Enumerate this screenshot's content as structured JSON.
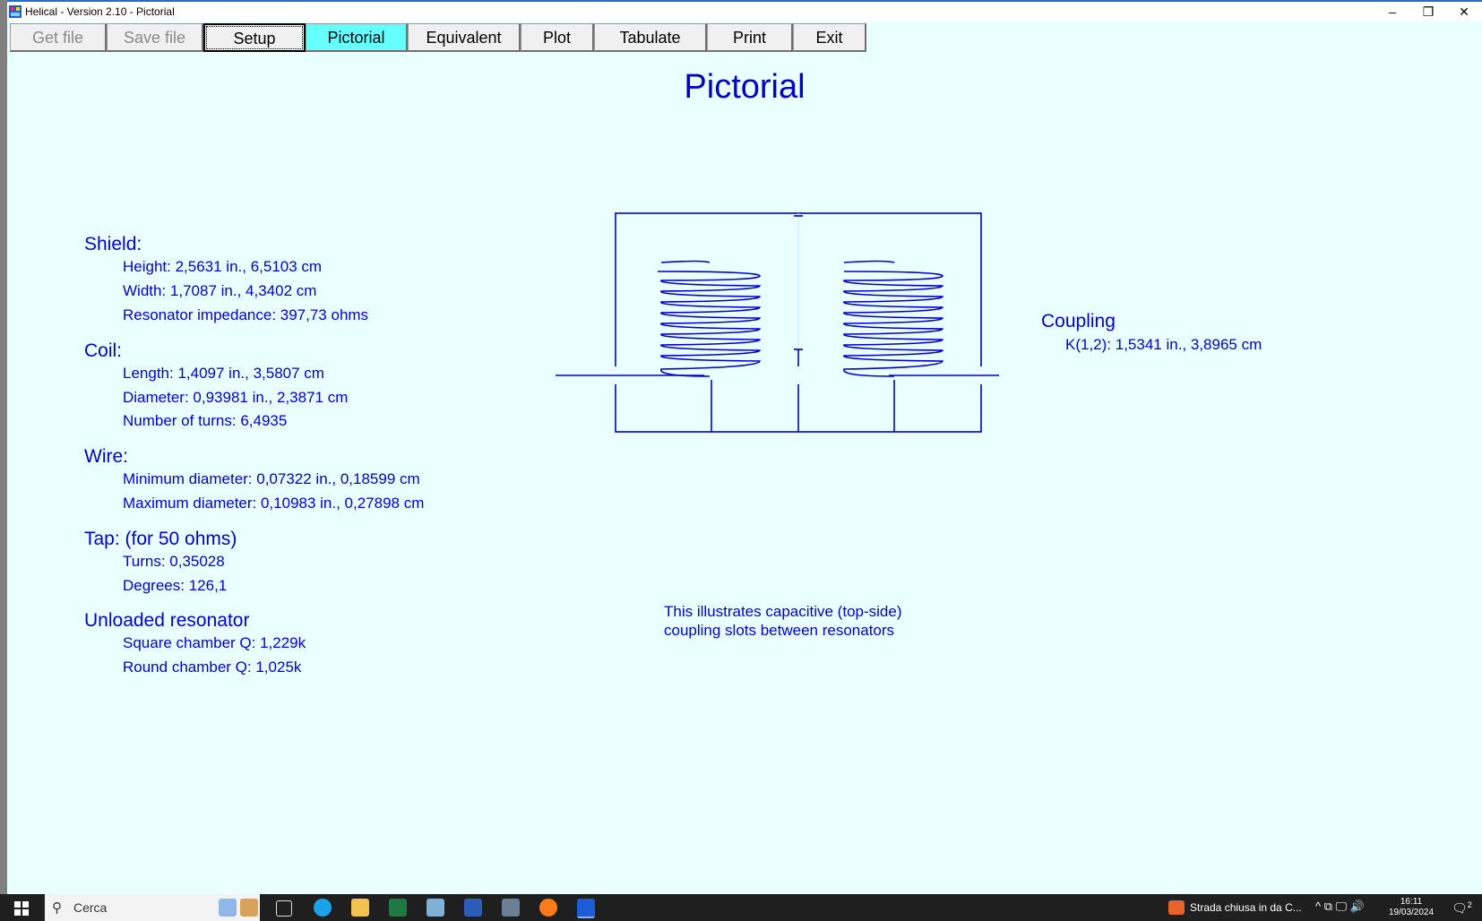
{
  "window": {
    "title": "Helical - Version 2.10 - Pictorial",
    "minimize": "–",
    "restore": "❐",
    "close": "✕"
  },
  "toolbar": {
    "get_file": "Get file",
    "save_file": "Save file",
    "setup": "Setup",
    "pictorial": "Pictorial",
    "equivalent": "Equivalent",
    "plot": "Plot",
    "tabulate": "Tabulate",
    "print": "Print",
    "exit": "Exit"
  },
  "page_title": "Pictorial",
  "shield": {
    "heading": "Shield:",
    "height": "Height: 2,5631 in.,  6,5103 cm",
    "width": "Width: 1,7087 in.,  4,3402 cm",
    "impedance": "Resonator impedance: 397,73 ohms"
  },
  "coil": {
    "heading": "Coil:",
    "length": "Length: 1,4097 in.,  3,5807 cm",
    "diameter": "Diameter: 0,93981 in.,  2,3871 cm",
    "turns": "Number of turns: 6,4935"
  },
  "wire": {
    "heading": "Wire:",
    "min": "Minimum diameter: 0,07322 in., 0,18599 cm",
    "max": "Maximum diameter: 0,10983 in., 0,27898 cm"
  },
  "tap": {
    "heading": "Tap: (for  50 ohms)",
    "turns": "Turns: 0,35028",
    "degrees": "Degrees: 126,1"
  },
  "unloaded": {
    "heading": "Unloaded resonator",
    "square": "Square chamber Q: 1,229k",
    "round": "Round chamber Q: 1,025k"
  },
  "coupling": {
    "heading": "Coupling",
    "k12": "K(1,2): 1,5341 in., 3,8965 cm"
  },
  "caption": {
    "line1": "This illustrates capacitive (top-side)",
    "line2": "coupling slots between resonators"
  },
  "taskbar": {
    "search_placeholder": "Cerca",
    "news": "Strada chiusa in da C...",
    "tray": "^  ⧉  🖵  🔊",
    "time": "16:11",
    "date": "19/03/2024",
    "notifications": "2"
  },
  "colors": {
    "text_blue": "#0000cc",
    "background": "#eaffff",
    "active_button": "#66ffff"
  }
}
